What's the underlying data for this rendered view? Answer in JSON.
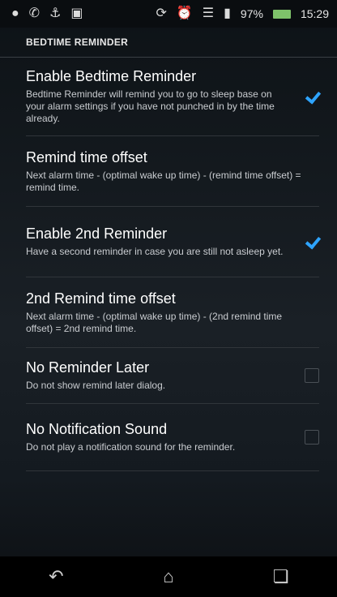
{
  "status_bar": {
    "left_icons": [
      "whatsapp-icon",
      "call-icon",
      "usb-icon",
      "image-icon"
    ],
    "right_icons": [
      "sync-icon",
      "alarm-icon",
      "wifi-icon",
      "signal-icon"
    ],
    "battery": "97%",
    "time": "15:29",
    "battery_color": "#7ec26a"
  },
  "section": {
    "title": "BEDTIME REMINDER"
  },
  "preferences": [
    {
      "title": "Enable Bedtime Reminder",
      "summary": "Bedtime Reminder will remind you to go to sleep base on your alarm settings if you have not punched in by the time already.",
      "checkbox": true,
      "checked": true
    },
    {
      "title": "Remind time offset",
      "summary": "Next alarm time - (optimal wake up time) - (remind time offset) = remind time.",
      "checkbox": false
    },
    {
      "title": "Enable 2nd Reminder",
      "summary": "Have a second reminder in case you are still not asleep yet.",
      "checkbox": true,
      "checked": true
    },
    {
      "title": "2nd Remind time offset",
      "summary": "Next alarm time - (optimal wake up time) - (2nd remind time offset) = 2nd remind time.",
      "checkbox": false
    },
    {
      "title": "No Reminder Later",
      "summary": "Do not show remind later dialog.",
      "checkbox": true,
      "checked": false
    },
    {
      "title": "No Notification Sound",
      "summary": "Do not play a notification sound for the reminder.",
      "checkbox": true,
      "checked": false
    }
  ],
  "nav_bar": {
    "icons": [
      "back-icon",
      "home-icon",
      "recent-apps-icon"
    ]
  },
  "colors": {
    "accent": "#2ea4ff"
  }
}
